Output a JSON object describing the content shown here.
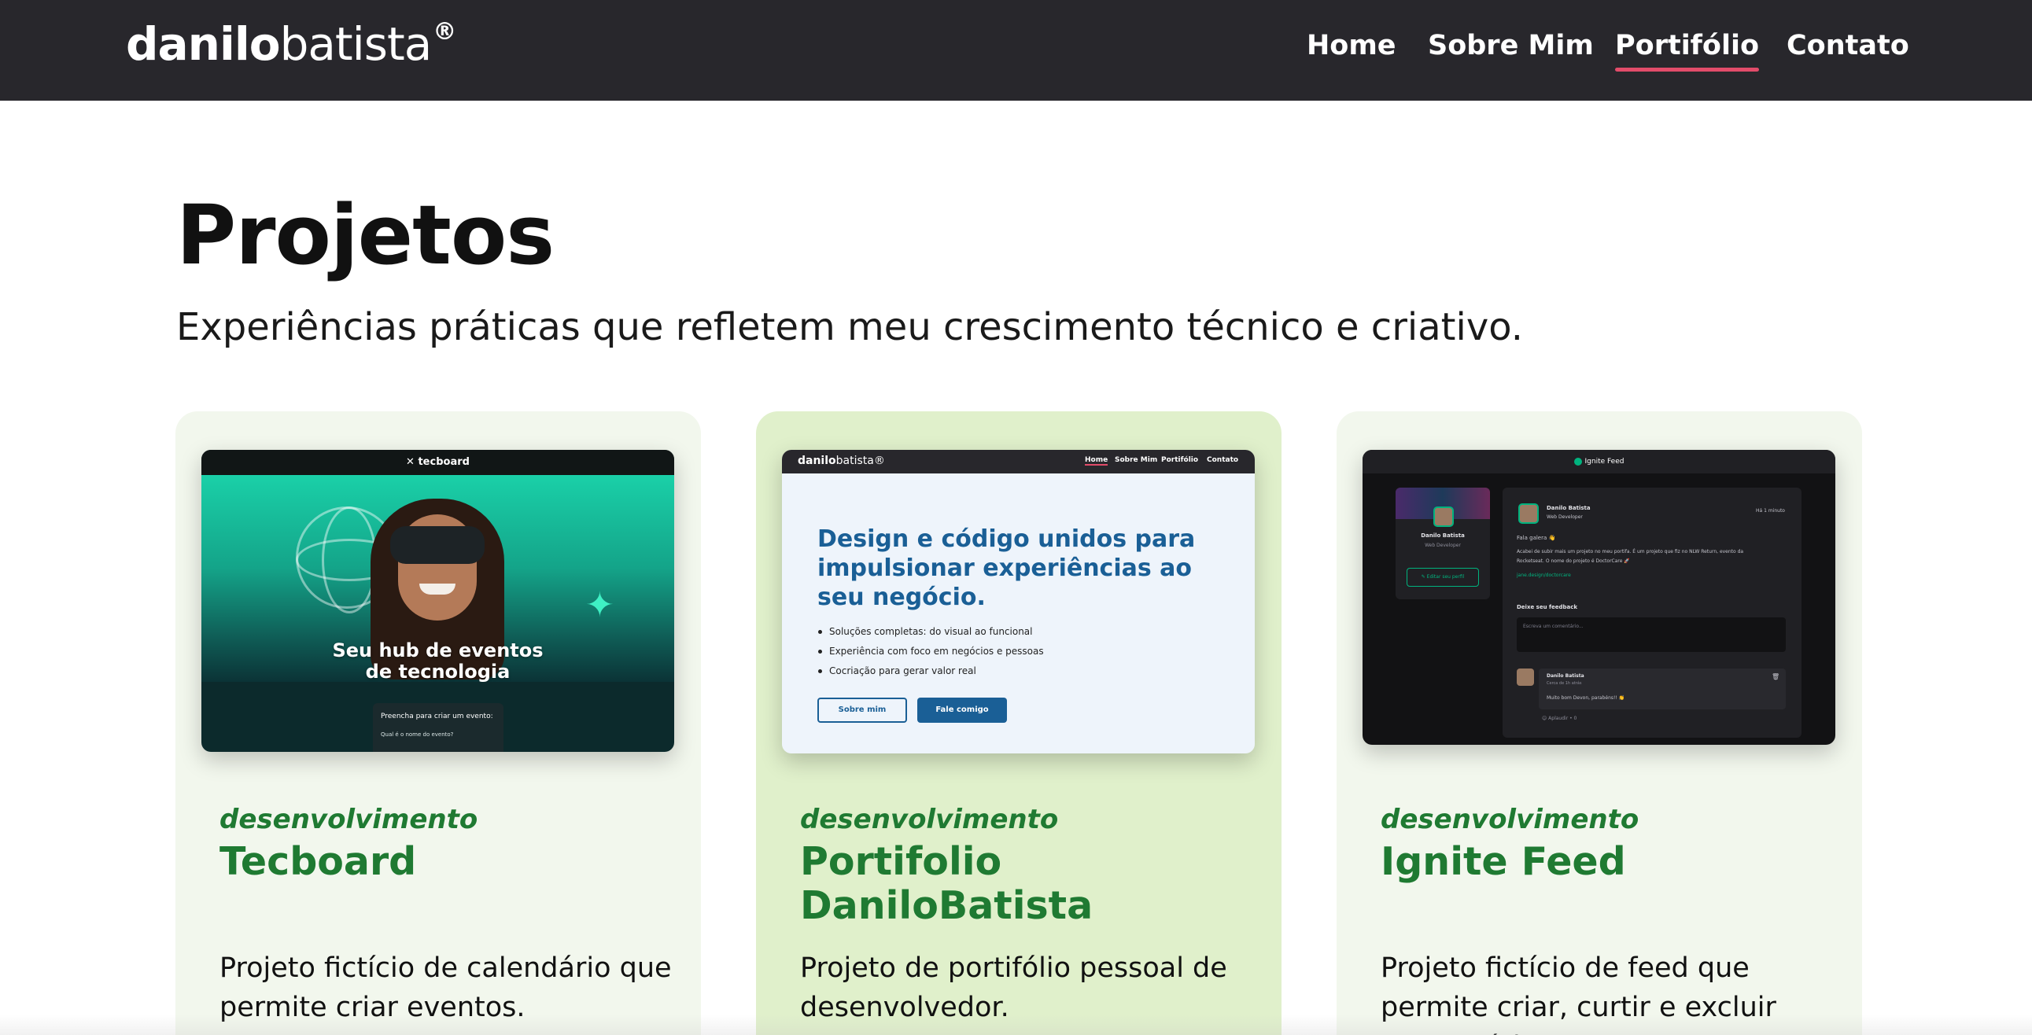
{
  "header": {
    "logo_bold": "danilo",
    "logo_light": "batista",
    "logo_mark": "®",
    "nav": [
      {
        "label": "Home",
        "active": false
      },
      {
        "label": "Sobre Mim",
        "active": false
      },
      {
        "label": "Portifólio",
        "active": true
      },
      {
        "label": "Contato",
        "active": false
      }
    ],
    "accent_color": "#e24c6a",
    "background_color": "#28272c"
  },
  "page": {
    "title": "Projetos",
    "subtitle": "Experiências práticas que refletem meu crescimento técnico e criativo."
  },
  "projects": [
    {
      "category": "desenvolvimento",
      "title": "Tecboard",
      "description": "Projeto fictício de calendário que permite criar eventos.",
      "card_color": "#f2f7ed",
      "preview": {
        "brand": "tecboard",
        "hero_text_line1": "Seu hub de eventos",
        "hero_text_line2": "de tecnologia",
        "form_title": "Preencha para criar um evento:",
        "form_question": "Qual é o nome do evento?"
      }
    },
    {
      "category": "desenvolvimento",
      "title": "Portifolio DaniloBatista",
      "description": "Projeto de portifólio pessoal de desenvolvedor.",
      "card_color": "#e0f0cb",
      "preview": {
        "logo_bold": "danilo",
        "logo_light": "batista®",
        "nav": [
          "Home",
          "Sobre Mim",
          "Portifólio",
          "Contato"
        ],
        "headline": "Design e código unidos para impulsionar experiências ao seu negócio.",
        "bullets": [
          "Soluções completas: do visual ao funcional",
          "Experiência com foco em negócios e pessoas",
          "Cocriação para gerar valor real"
        ],
        "button_outline": "Sobre mim",
        "button_solid": "Fale comigo"
      }
    },
    {
      "category": "desenvolvimento",
      "title": "Ignite Feed",
      "description": "Projeto fictício de feed que permite criar, curtir e excluir comentários.",
      "card_color": "#f2f7ed",
      "preview": {
        "app_name": "Ignite Feed",
        "profile_name": "Danilo Batista",
        "profile_role": "Web Developer",
        "edit_profile": "Editar seu perfil",
        "post_author": "Danilo Batista",
        "post_role": "Web Developer",
        "post_time": "Há 1 minuto",
        "post_greeting": "Fala galera 👋",
        "post_body_1": "Acabei de subir mais um projeto no meu portifa. É um projeto que fiz no NLW Return, evento da",
        "post_body_2": "Rocketseat. O nome do projeto é DoctorCare 🚀",
        "post_link": "jane.design/doctorcare",
        "feedback_label": "Deixe seu feedback",
        "comment_placeholder": "Escreva um comentário...",
        "comment_author": "Danilo Batista",
        "comment_time": "Cerca de 1h atrás",
        "comment_text": "Muito bom Devon, parabéns!! 👏",
        "comment_likes": "Aplaudir • 0"
      }
    }
  ]
}
